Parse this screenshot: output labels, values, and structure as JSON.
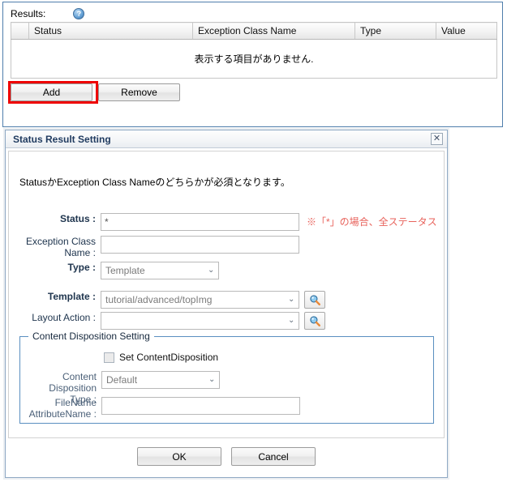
{
  "results_panel": {
    "label": "Results:",
    "help_icon": "help-circle-icon",
    "help_glyph": "?",
    "table": {
      "columns": [
        "",
        "Status",
        "Exception Class Name",
        "Type",
        "Value"
      ],
      "empty_message": "表示する項目がありません.",
      "rows": []
    },
    "buttons": {
      "add": "Add",
      "remove": "Remove"
    },
    "highlight_color": "#ee0000",
    "border_color": "#4f7eac"
  },
  "dialog": {
    "title": "Status Result Setting",
    "close_glyph": "✕",
    "note": "StatusかException Class Nameのどちらかが必須となります。",
    "fields": {
      "status": {
        "label": "Status :",
        "value": "*",
        "hint": "※「*」の場合、全ステータス",
        "hint_color": "#e8635c"
      },
      "exception_class_name": {
        "label_line1": "Exception Class",
        "label_line2": "Name :",
        "value": ""
      },
      "type": {
        "label": "Type :",
        "value": "Template",
        "chevron": "⌄"
      },
      "template": {
        "label": "Template :",
        "value": "tutorial/advanced/topImg",
        "chevron": "⌄",
        "browse_icon": "magnifier-icon"
      },
      "layout_action": {
        "label": "Layout Action :",
        "value": "",
        "chevron": "⌄",
        "browse_icon": "magnifier-icon"
      }
    },
    "content_disposition": {
      "legend": "Content Disposition Setting",
      "checkbox_label": "Set ContentDisposition",
      "checked": false,
      "type": {
        "label_line1": "Content Disposition",
        "label_line2": "Type :",
        "value": "Default",
        "chevron": "⌄"
      },
      "filename_attribute": {
        "label_line1": "FileName",
        "label_line2": "AttributeName :",
        "value": ""
      }
    },
    "footer": {
      "ok": "OK",
      "cancel": "Cancel"
    }
  }
}
